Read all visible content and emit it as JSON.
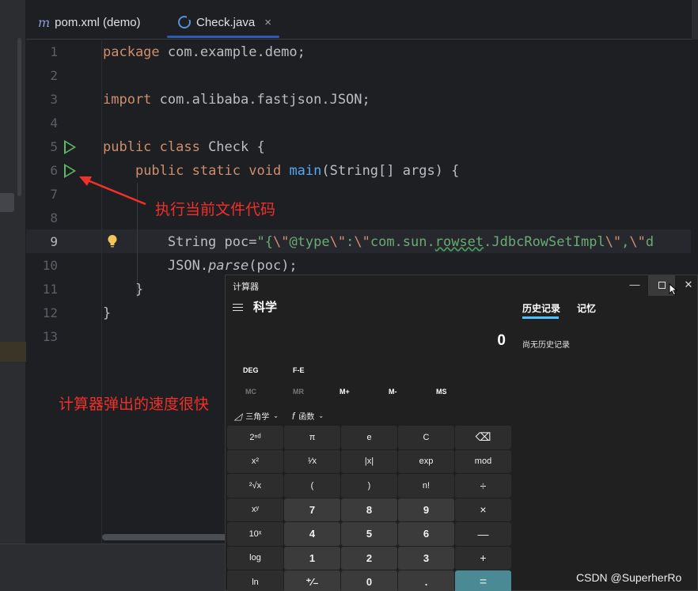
{
  "tabs": [
    {
      "label": "pom.xml (demo)",
      "icon": "maven-m-icon"
    },
    {
      "label": "Check.java",
      "icon": "java-class-icon",
      "close": "×",
      "active": true
    }
  ],
  "editor": {
    "line_numbers": [
      "1",
      "2",
      "3",
      "4",
      "5",
      "6",
      "7",
      "8",
      "9",
      "10",
      "11",
      "12",
      "13"
    ],
    "current_line": "9"
  },
  "annotations": {
    "run_hint": "执行当前文件代码",
    "calc_speed": "计算器弹出的速度很快"
  },
  "calculator": {
    "title": "计算器",
    "mode": "科学",
    "display": "0",
    "history_tab": "历史记录",
    "memory_tab": "记忆",
    "no_history": "尚无历史记录",
    "angle_mode": "DEG",
    "notation": "F-E",
    "memory_buttons": [
      "MC",
      "MR",
      "M+",
      "M-",
      "MS"
    ],
    "trig_label": "三角学",
    "func_label": "函数",
    "window_buttons": {
      "minimize": "—",
      "close": "✕"
    },
    "keys": [
      "2ⁿᵈ",
      "π",
      "e",
      "C",
      "⌫",
      "x²",
      "¹⁄x",
      "|x|",
      "exp",
      "mod",
      "²√x",
      "(",
      ")",
      "n!",
      "÷",
      "xʸ",
      "7",
      "8",
      "9",
      "×",
      "10ˣ",
      "4",
      "5",
      "6",
      "—",
      "log",
      "1",
      "2",
      "3",
      "+",
      "ln",
      "⁺⁄₋",
      "0",
      ".",
      "="
    ]
  },
  "watermark": "CSDN @SuperherRo",
  "colors": {
    "accent": "#3574f0",
    "run_green": "#5fb865",
    "annotation_red": "#f0302a",
    "equals": "#4a8a94"
  }
}
